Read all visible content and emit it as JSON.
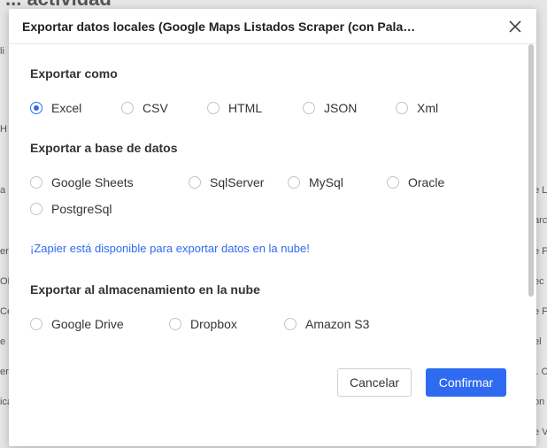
{
  "background": {
    "title": "... actividad",
    "fragments_left": [
      "li",
      "H",
      "a",
      "erí",
      "OE",
      "Ce",
      "e",
      "er",
      "ica"
    ],
    "fragments_right": [
      "e L",
      "arc",
      "e F",
      "ec",
      "e F",
      "el",
      "i. C",
      "on",
      "e V"
    ]
  },
  "dialog": {
    "title": "Exportar datos locales (Google Maps Listados Scraper (con Palabras C...",
    "close_icon": "close-icon",
    "export_as": {
      "title": "Exportar como",
      "options": [
        "Excel",
        "CSV",
        "HTML",
        "JSON",
        "Xml"
      ],
      "selected": "Excel"
    },
    "export_db": {
      "title": "Exportar a base de datos",
      "options": [
        "Google Sheets",
        "SqlServer",
        "MySql",
        "Oracle",
        "PostgreSql"
      ]
    },
    "zapier_link": "¡Zapier está disponible para exportar datos en la nube!",
    "export_cloud": {
      "title": "Exportar al almacenamiento en la nube",
      "options": [
        "Google Drive",
        "Dropbox",
        "Amazon S3"
      ]
    },
    "buttons": {
      "cancel": "Cancelar",
      "confirm": "Confirmar"
    }
  },
  "colors": {
    "accent": "#2f6bf0",
    "radio_border": "#c4c4c4"
  }
}
